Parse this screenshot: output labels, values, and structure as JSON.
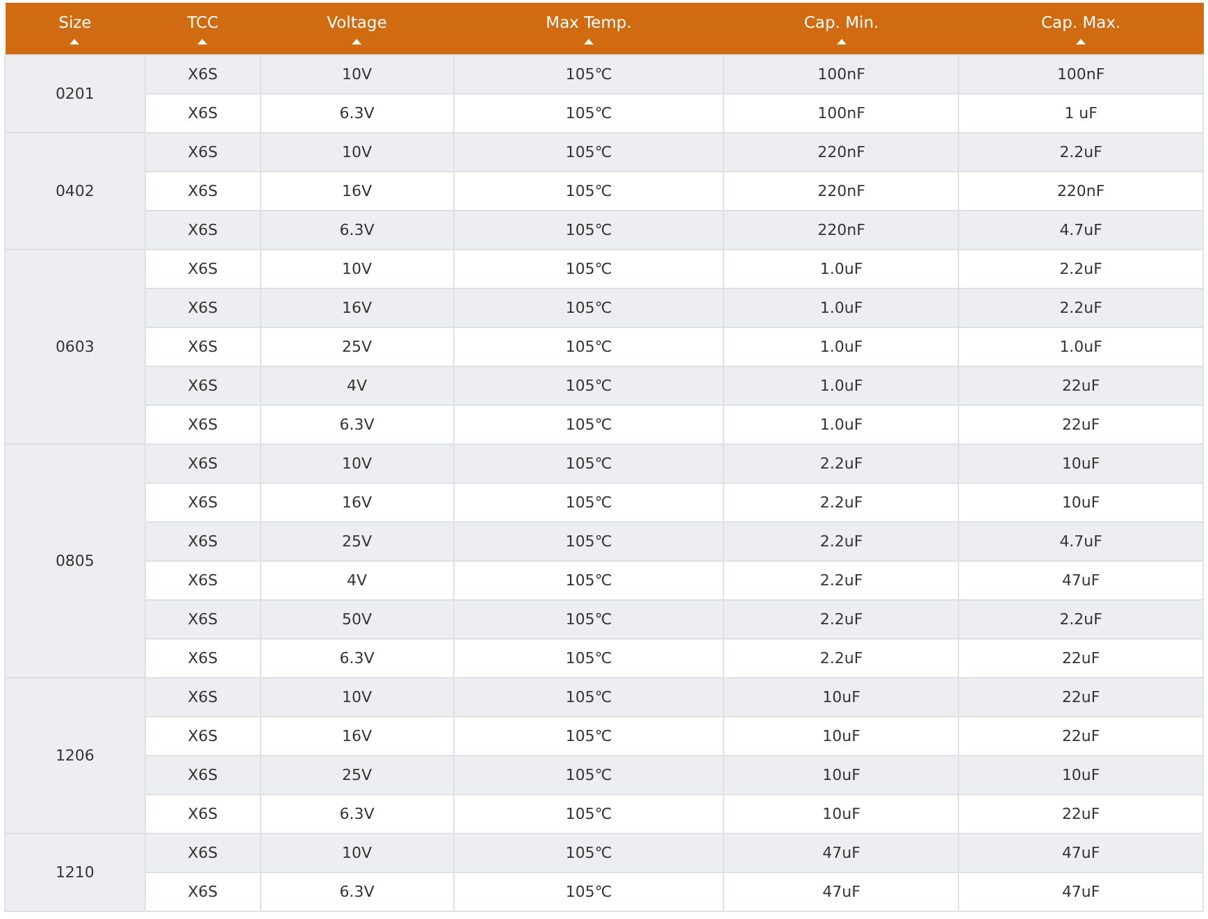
{
  "table": {
    "columns": [
      "Size",
      "TCC",
      "Voltage",
      "Max Temp.",
      "Cap. Min.",
      "Cap. Max."
    ],
    "groups": [
      {
        "size": "0201",
        "rows": [
          [
            "X6S",
            "10V",
            "105℃",
            "100nF",
            "100nF"
          ],
          [
            "X6S",
            "6.3V",
            "105℃",
            "100nF",
            "1 uF"
          ]
        ]
      },
      {
        "size": "0402",
        "rows": [
          [
            "X6S",
            "10V",
            "105℃",
            "220nF",
            "2.2uF"
          ],
          [
            "X6S",
            "16V",
            "105℃",
            "220nF",
            "220nF"
          ],
          [
            "X6S",
            "6.3V",
            "105℃",
            "220nF",
            "4.7uF"
          ]
        ]
      },
      {
        "size": "0603",
        "rows": [
          [
            "X6S",
            "10V",
            "105℃",
            "1.0uF",
            "2.2uF"
          ],
          [
            "X6S",
            "16V",
            "105℃",
            "1.0uF",
            "2.2uF"
          ],
          [
            "X6S",
            "25V",
            "105℃",
            "1.0uF",
            "1.0uF"
          ],
          [
            "X6S",
            "4V",
            "105℃",
            "1.0uF",
            "22uF"
          ],
          [
            "X6S",
            "6.3V",
            "105℃",
            "1.0uF",
            "22uF"
          ]
        ]
      },
      {
        "size": "0805",
        "rows": [
          [
            "X6S",
            "10V",
            "105℃",
            "2.2uF",
            "10uF"
          ],
          [
            "X6S",
            "16V",
            "105℃",
            "2.2uF",
            "10uF"
          ],
          [
            "X6S",
            "25V",
            "105℃",
            "2.2uF",
            "4.7uF"
          ],
          [
            "X6S",
            "4V",
            "105℃",
            "2.2uF",
            "47uF"
          ],
          [
            "X6S",
            "50V",
            "105℃",
            "2.2uF",
            "2.2uF"
          ],
          [
            "X6S",
            "6.3V",
            "105℃",
            "2.2uF",
            "22uF"
          ]
        ]
      },
      {
        "size": "1206",
        "rows": [
          [
            "X6S",
            "10V",
            "105℃",
            "10uF",
            "22uF"
          ],
          [
            "X6S",
            "16V",
            "105℃",
            "10uF",
            "22uF"
          ],
          [
            "X6S",
            "25V",
            "105℃",
            "10uF",
            "10uF"
          ],
          [
            "X6S",
            "6.3V",
            "105℃",
            "10uF",
            "22uF"
          ]
        ]
      },
      {
        "size": "1210",
        "rows": [
          [
            "X6S",
            "10V",
            "105℃",
            "47uF",
            "47uF"
          ],
          [
            "X6S",
            "6.3V",
            "105℃",
            "47uF",
            "47uF"
          ]
        ]
      }
    ]
  }
}
